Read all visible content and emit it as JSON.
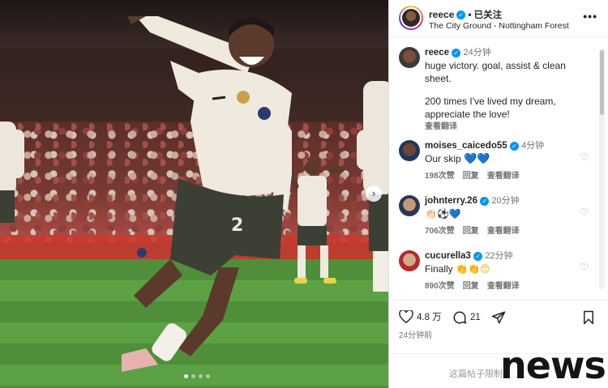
{
  "post": {
    "username": "reece",
    "follow_label": "已关注",
    "location": "The City Ground - Nottingham Forest"
  },
  "caption": {
    "username": "reece",
    "time": "24分钟",
    "text_line1": "huge victory. goal, assist & clean",
    "text_line2": "sheet.",
    "text_line3": "200 times I've lived my dream,",
    "text_line4": "appreciate the love!",
    "translate": "查看翻译"
  },
  "comments": [
    {
      "username": "moises_caicedo55",
      "time": "4分钟",
      "text": "Our skip",
      "likes": "198次赞",
      "reply": "回复",
      "translate": "查看翻译",
      "emoji": "💙💙"
    },
    {
      "username": "johnterry.26",
      "time": "20分钟",
      "text": "",
      "likes": "706次赞",
      "reply": "回复",
      "translate": "查看翻译",
      "emoji": "👏🏻⚽💙"
    },
    {
      "username": "cucurella3",
      "time": "22分钟",
      "text": "Finally",
      "likes": "890次赞",
      "reply": "回复",
      "translate": "查看翻译",
      "emoji": "👏👏😍"
    }
  ],
  "actions": {
    "likes_count": "4.8 万",
    "comments_count": "21"
  },
  "time_ago": "24分钟前",
  "restricted_text": "这篇帖子限制",
  "watermark": "news",
  "icons": {
    "more": "more-icon",
    "heart": "heart-icon",
    "comment": "comment-icon",
    "share": "share-icon",
    "save": "bookmark-icon",
    "next": "chevron-right-icon"
  },
  "colors": {
    "verified": "#0095f6",
    "muted": "#737373",
    "text": "#262626"
  }
}
